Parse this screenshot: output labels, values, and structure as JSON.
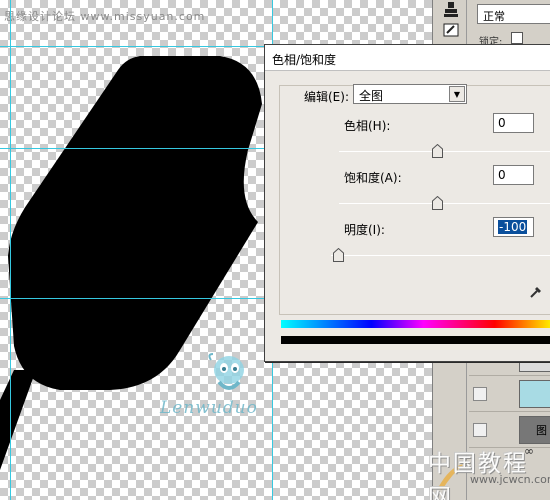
{
  "canvas": {
    "watermark_top": "思缘设计论坛 www.missyuan.com",
    "mascot_text": "Lenwuduo"
  },
  "right_panel": {
    "blend_mode": "正常",
    "lock_label": "锁定:",
    "layer_suffix": "图"
  },
  "dialog": {
    "title": "色相/饱和度",
    "edit_label": "编辑(E):",
    "edit_value": "全图",
    "hue_label": "色相(H):",
    "hue_value": "0",
    "hue_slider_value": 0,
    "saturation_label": "饱和度(A):",
    "saturation_value": "0",
    "saturation_slider_value": 0,
    "lightness_label": "明度(I):",
    "lightness_value": "-100",
    "lightness_slider_value": -100
  },
  "watermark": {
    "big": "中国教程网",
    "small": "www.jcwcn.com"
  },
  "icons": [
    "stamp-icon",
    "history-brush-icon",
    "dropdown-arrow-icon",
    "eyedropper-icon",
    "link-icon",
    "eye-icon"
  ]
}
